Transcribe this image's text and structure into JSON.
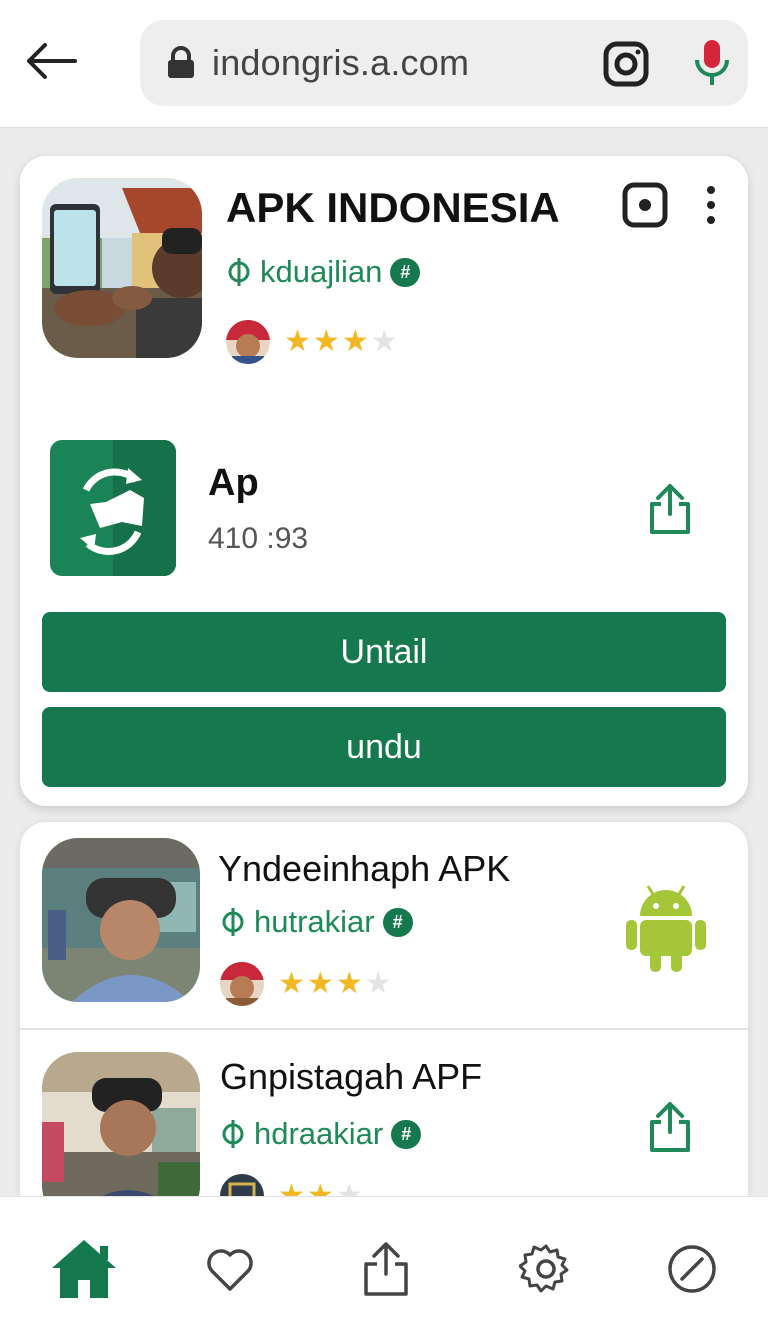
{
  "browser": {
    "url": "indongris.a.com",
    "back_icon": "arrow-left-icon",
    "lock_icon": "lock-icon",
    "camera_icon": "instagram-icon",
    "mic_icon": "mic-icon"
  },
  "featured": {
    "title": "APK INDONESIA",
    "developer": "kduajlian",
    "dev_badge": "#",
    "rating": 3,
    "rating_max": 4,
    "screenshot_icon": "record-icon",
    "more_icon": "more-vertical-icon",
    "app": {
      "name": "Ap",
      "size": "410 :93",
      "share_icon": "share-icon"
    },
    "primary_button": "Untail",
    "secondary_button": "undu"
  },
  "list": [
    {
      "title": "Yndeeinhaph APK",
      "developer": "hutrakiar",
      "dev_badge": "#",
      "rating": 3,
      "rating_max": 4,
      "action_icon": "android-icon"
    },
    {
      "title": "Gnpistagah APF",
      "developer": "hdraakiar",
      "dev_badge": "#",
      "rating": 2,
      "rating_max": 3,
      "action_icon": "share-icon"
    }
  ],
  "bottom_nav": [
    {
      "name": "home",
      "icon": "home-icon",
      "active": true
    },
    {
      "name": "favorites",
      "icon": "heart-icon",
      "active": false
    },
    {
      "name": "share",
      "icon": "share-icon",
      "active": false
    },
    {
      "name": "settings",
      "icon": "gear-icon",
      "active": false
    },
    {
      "name": "blocked",
      "icon": "block-icon",
      "active": false
    }
  ],
  "colors": {
    "brand_green": "#16794d",
    "star": "#f2b824"
  }
}
